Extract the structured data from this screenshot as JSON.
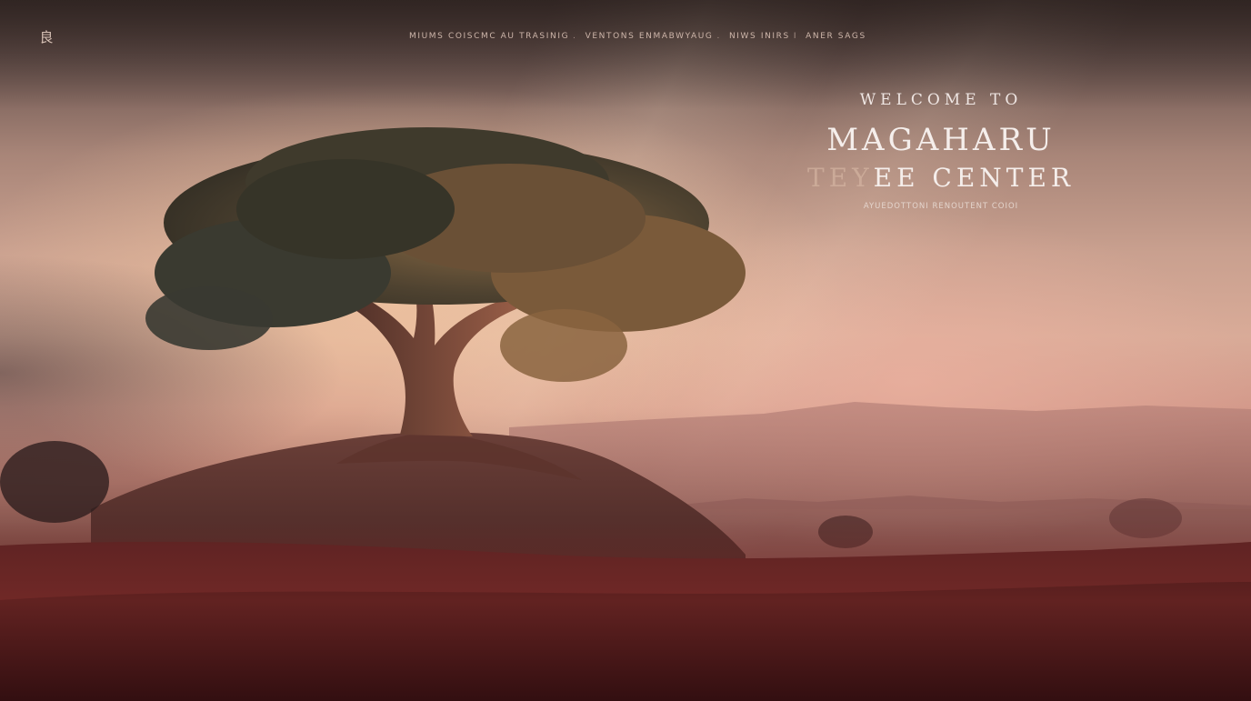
{
  "header": {
    "logo_icon": "tree-logo-icon",
    "logo_glyph": "良",
    "nav": [
      {
        "label": "MIUMS COISCMC AU TRASINIG"
      },
      {
        "label": "VENTONS ENMABWYAUG"
      },
      {
        "label": "NIWS INIRS"
      },
      {
        "label": "ANER SAGS"
      }
    ],
    "nav_separators": [
      ".",
      ".",
      "I",
      ""
    ]
  },
  "hero": {
    "kicker": "WELCOME TO",
    "title_line_1": "MAGAHARU",
    "title_line_2_faded": "TEY",
    "title_line_2_rest": "EE CENTER",
    "subtitle": "AYUEDOTTONI RENOUTENT COIOI"
  },
  "background": {
    "scene": "tree-on-hill-at-sunrise-image",
    "colors": {
      "sky_top": "#4a3a36",
      "sky_glow": "#d9ab98",
      "grass": "#7a2a28",
      "text": "#f0e6e2"
    }
  }
}
